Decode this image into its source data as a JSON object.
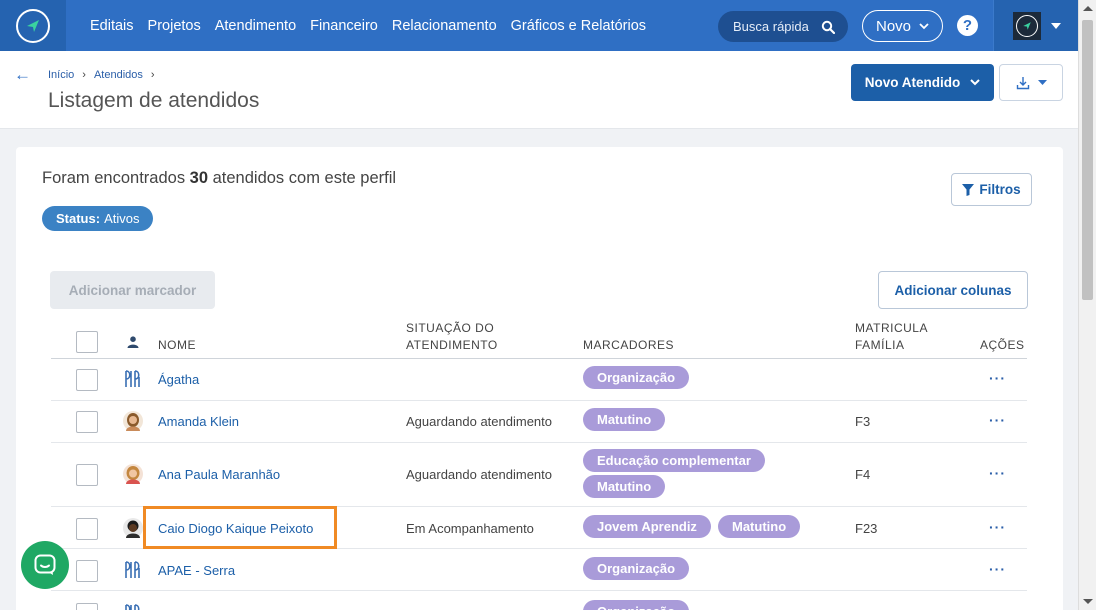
{
  "nav": {
    "items": [
      "Editais",
      "Projetos",
      "Atendimento",
      "Financeiro",
      "Relacionamento",
      "Gráficos e Relatórios"
    ],
    "search_placeholder": "Busca rápida",
    "novo_label": "Novo",
    "help_label": "?"
  },
  "breadcrumb": [
    "Início",
    "Atendidos"
  ],
  "page_title": "Listagem de atendidos",
  "actions": {
    "novo_atendido": "Novo Atendido"
  },
  "summary": {
    "prefix": "Foram encontrados",
    "count": "30",
    "suffix": "atendidos com este perfil"
  },
  "filter_pill": {
    "key": "Status:",
    "value": "Ativos"
  },
  "filtros_label": "Filtros",
  "add_marcador_label": "Adicionar marcador",
  "add_colunas_label": "Adicionar colunas",
  "table": {
    "headers": {
      "nome": "NOME",
      "situacao_1": "SITUAÇÃO DO",
      "situacao_2": "ATENDIMENTO",
      "marcadores": "MARCADORES",
      "matricula_1": "MATRICULA",
      "matricula_2": "FAMÍLIA",
      "acoes": "AÇÕES"
    },
    "rows": [
      {
        "name": "Ágatha",
        "situacao": "",
        "tags": [
          "Organização"
        ],
        "matricula": "",
        "actions": "···",
        "avatar": "org-icon"
      },
      {
        "name": "Amanda Klein",
        "situacao": "Aguardando atendimento",
        "tags": [
          "Matutino"
        ],
        "matricula": "F3",
        "actions": "···",
        "avatar": "person-avatar"
      },
      {
        "name": "Ana Paula Maranhão",
        "situacao": "Aguardando atendimento",
        "tags": [
          "Educação complementar",
          "Matutino"
        ],
        "matricula": "F4",
        "actions": "···",
        "avatar": "person-avatar"
      },
      {
        "name": "Caio Diogo Kaique Peixoto",
        "situacao": "Em Acompanhamento",
        "tags": [
          "Jovem Aprendiz",
          "Matutino"
        ],
        "matricula": "F23",
        "actions": "···",
        "avatar": "person-avatar"
      },
      {
        "name": "APAE - Serra",
        "situacao": "",
        "tags": [
          "Organização"
        ],
        "matricula": "",
        "actions": "···",
        "avatar": "org-icon"
      },
      {
        "name": "",
        "situacao": "",
        "tags": [
          "Organização"
        ],
        "matricula": "",
        "actions": "",
        "avatar": "org-icon"
      }
    ]
  },
  "colors": {
    "topbar": "#2f6fc4",
    "primary_button": "#1c5fa8",
    "tag": "#a99bd9",
    "highlight": "#f08a24",
    "chat": "#1fa864"
  }
}
